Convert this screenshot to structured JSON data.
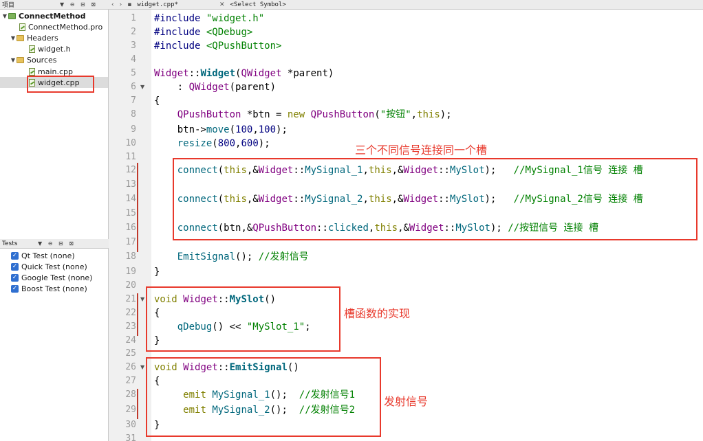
{
  "project_panel": {
    "title": "项目",
    "toolbar_icons": "▼ ⊖ ⊟ ⊠",
    "tree": [
      {
        "label": "ConnectMethod",
        "level": 0
      },
      {
        "label": "ConnectMethod.pro",
        "level": 1
      },
      {
        "label": "Headers",
        "level": 1
      },
      {
        "label": "widget.h",
        "level": 2
      },
      {
        "label": "Sources",
        "level": 1
      },
      {
        "label": "main.cpp",
        "level": 2
      },
      {
        "label": "widget.cpp",
        "level": 2,
        "selected": true
      }
    ]
  },
  "tests_panel": {
    "title": "Tests",
    "toolbar_icons": "▼ ⊖ ⊟ ⊠",
    "items": [
      {
        "label": "Qt Test (none)",
        "checked": true
      },
      {
        "label": "Quick Test (none)",
        "checked": true
      },
      {
        "label": "Google Test (none)",
        "checked": true
      },
      {
        "label": "Boost Test (none)",
        "checked": true
      }
    ]
  },
  "editor": {
    "file_tab": "widget.cpp*",
    "symbol_selector": "<Select Symbol>",
    "lines": [
      {
        "n": "1"
      },
      {
        "n": "2"
      },
      {
        "n": "3"
      },
      {
        "n": "4"
      },
      {
        "n": "5"
      },
      {
        "n": "6"
      },
      {
        "n": "7"
      },
      {
        "n": "8"
      },
      {
        "n": "9"
      },
      {
        "n": "10"
      },
      {
        "n": "11"
      },
      {
        "n": "12"
      },
      {
        "n": "13"
      },
      {
        "n": "14"
      },
      {
        "n": "15"
      },
      {
        "n": "16"
      },
      {
        "n": "17"
      },
      {
        "n": "18"
      },
      {
        "n": "19"
      },
      {
        "n": "20"
      },
      {
        "n": "21"
      },
      {
        "n": "22"
      },
      {
        "n": "23"
      },
      {
        "n": "24"
      },
      {
        "n": "25"
      },
      {
        "n": "26"
      },
      {
        "n": "27"
      },
      {
        "n": "28"
      },
      {
        "n": "29"
      },
      {
        "n": "30"
      },
      {
        "n": "31"
      }
    ],
    "code": {
      "l1_pp": "#include",
      "l1_str": " \"widget.h\"",
      "l2_pp": "#include",
      "l2_str": " <QDebug>",
      "l3_pp": "#include",
      "l3_str": " <QPushButton>",
      "l5_a": "Widget",
      "l5_b": "::",
      "l5_c": "Widget",
      "l5_d": "(",
      "l5_e": "QWidget",
      "l5_f": " *parent)",
      "l6_a": "    : ",
      "l6_b": "QWidget",
      "l6_c": "(parent)",
      "l7": "{",
      "l8_a": "    ",
      "l8_b": "QPushButton",
      "l8_c": " *btn = ",
      "l8_d": "new",
      "l8_e": " ",
      "l8_f": "QPushButton",
      "l8_g": "(",
      "l8_h": "\"按钮\"",
      "l8_i": ",",
      "l8_j": "this",
      "l8_k": ");",
      "l9_a": "    btn->",
      "l9_b": "move",
      "l9_c": "(",
      "l9_d": "100",
      "l9_e": ",",
      "l9_f": "100",
      "l9_g": ");",
      "l10_a": "    ",
      "l10_b": "resize",
      "l10_c": "(",
      "l10_d": "800",
      "l10_e": ",",
      "l10_f": "600",
      "l10_g": ");",
      "l12_a": "    ",
      "l12_b": "connect",
      "l12_c": "(",
      "l12_d": "this",
      "l12_e": ",&",
      "l12_f": "Widget",
      "l12_g": "::",
      "l12_h": "MySignal_1",
      "l12_i": ",",
      "l12_j": "this",
      "l12_k": ",&",
      "l12_l": "Widget",
      "l12_m": "::",
      "l12_n": "MySlot",
      "l12_o": ");   ",
      "l12_p": "//MySignal_1信号 连接 槽",
      "l14_a": "    ",
      "l14_b": "connect",
      "l14_c": "(",
      "l14_d": "this",
      "l14_e": ",&",
      "l14_f": "Widget",
      "l14_g": "::",
      "l14_h": "MySignal_2",
      "l14_i": ",",
      "l14_j": "this",
      "l14_k": ",&",
      "l14_l": "Widget",
      "l14_m": "::",
      "l14_n": "MySlot",
      "l14_o": ");   ",
      "l14_p": "//MySignal_2信号 连接 槽",
      "l16_a": "    ",
      "l16_b": "connect",
      "l16_c": "(btn,&",
      "l16_d": "QPushButton",
      "l16_e": "::",
      "l16_f": "clicked",
      "l16_g": ",",
      "l16_h": "this",
      "l16_i": ",&",
      "l16_j": "Widget",
      "l16_k": "::",
      "l16_l": "MySlot",
      "l16_m": "); ",
      "l16_n": "//按钮信号 连接 槽",
      "l18_a": "    ",
      "l18_b": "EmitSignal",
      "l18_c": "(); ",
      "l18_d": "//发射信号",
      "l19": "}",
      "l21_a": "void",
      "l21_b": " ",
      "l21_c": "Widget",
      "l21_d": "::",
      "l21_e": "MySlot",
      "l21_f": "()",
      "l22": "{",
      "l23_a": "    ",
      "l23_b": "qDebug",
      "l23_c": "() << ",
      "l23_d": "\"MySlot_1\"",
      "l23_e": ";",
      "l24": "}",
      "l26_a": "void",
      "l26_b": " ",
      "l26_c": "Widget",
      "l26_d": "::",
      "l26_e": "EmitSignal",
      "l26_f": "()",
      "l27": "{",
      "l28_a": "     ",
      "l28_b": "emit",
      "l28_c": " ",
      "l28_d": "MySignal_1",
      "l28_e": "();  ",
      "l28_f": "//发射信号1",
      "l29_a": "     ",
      "l29_b": "emit",
      "l29_c": " ",
      "l29_d": "MySignal_2",
      "l29_e": "();  ",
      "l29_f": "//发射信号2",
      "l30": "}"
    }
  },
  "annotations": {
    "connect_note": "三个不同信号连接同一个槽",
    "slot_note": "槽函数的实现",
    "emit_note": "发射信号"
  },
  "colors": {
    "highlight": "#e8392c",
    "keyword": "#808000",
    "type": "#800080",
    "string": "#008000",
    "function": "#00677c"
  }
}
